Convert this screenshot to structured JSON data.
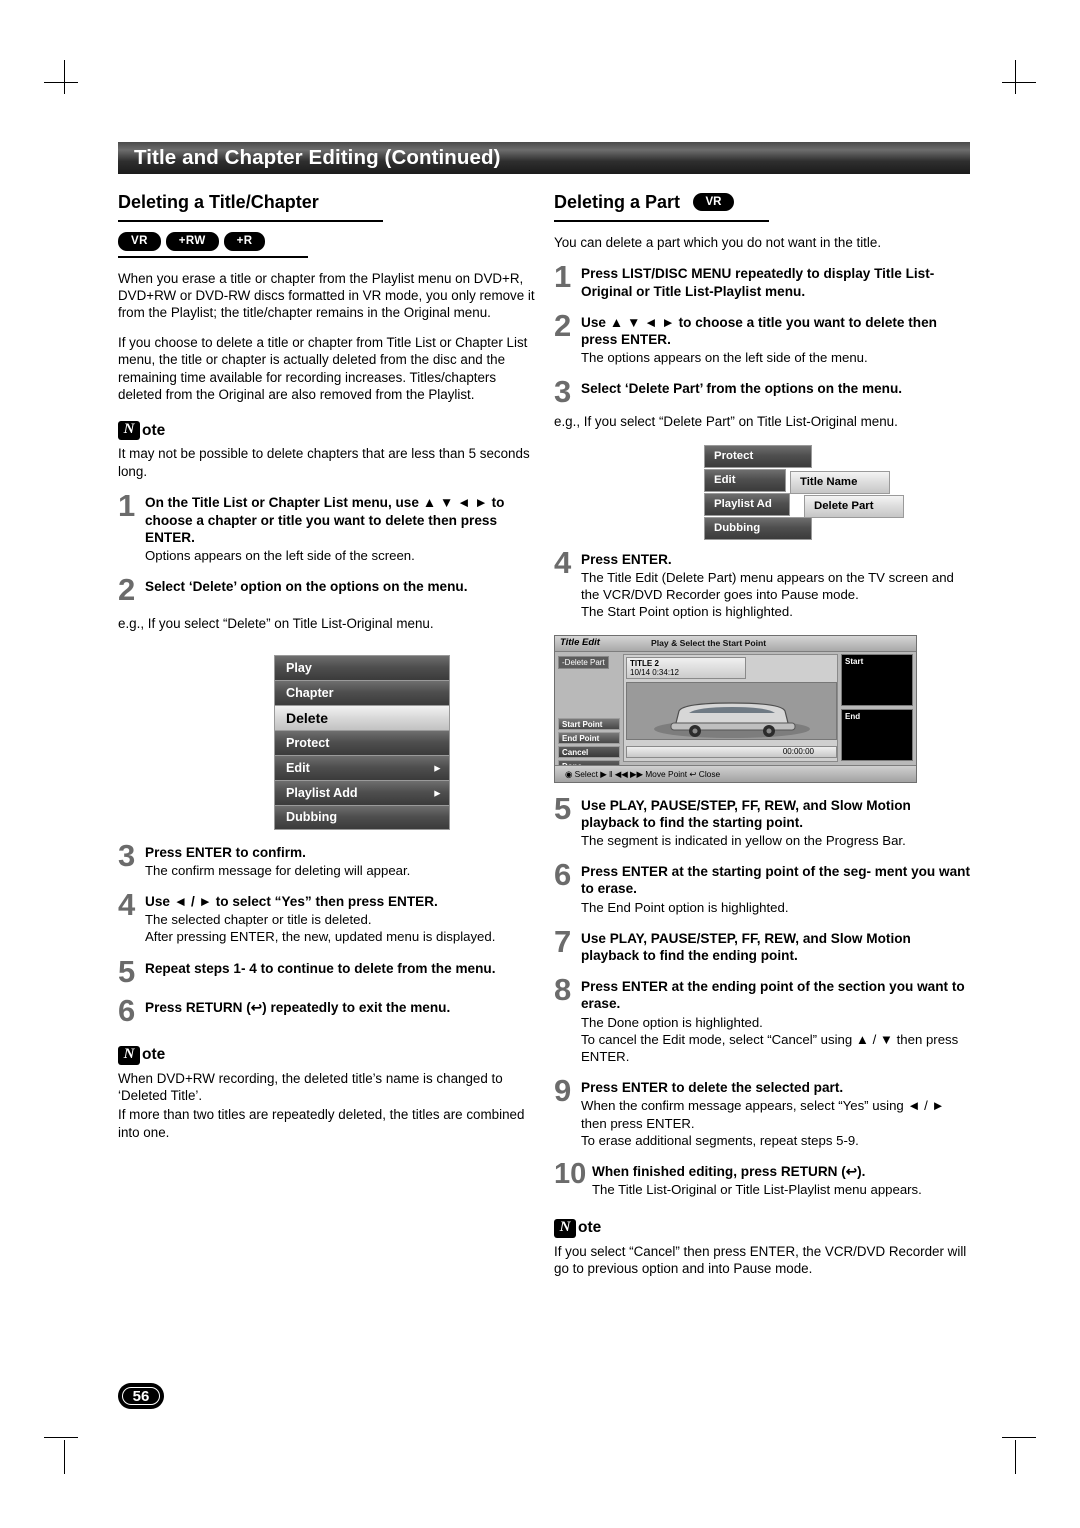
{
  "header": {
    "title": "Title and Chapter Editing (Continued)"
  },
  "page_number": "56",
  "left": {
    "section_title": "Deleting a Title/Chapter",
    "disc_tags": [
      "VR",
      "+RW",
      "+R"
    ],
    "paragraphs": [
      "When you erase a title or chapter from the Playlist menu on DVD+R, DVD+RW or DVD-RW discs formatted in VR mode, you only remove it from the Playlist; the title/chapter remains in the Original menu.",
      "If you choose to delete a title or chapter from Title List or Chapter List menu, the title or chapter is actually deleted from the disc and the remaining time available for recording increases. Titles/chapters deleted from the Original are also removed from the Playlist."
    ],
    "note1": {
      "label": "ote",
      "text": "It may not be possible to delete chapters that are less than 5 seconds long."
    },
    "steps": [
      {
        "num": "1",
        "head": "On the Title List or Chapter List menu, use ▲ ▼ ◄ ► to choose a chapter or title you want to delete then press ENTER.",
        "sub": "Options appears on the left side of the screen."
      },
      {
        "num": "2",
        "head": "Select ‘Delete’ option on the options on the menu.",
        "sub": ""
      }
    ],
    "eg_text": "e.g., If you select “Delete” on Title List-Original menu.",
    "options_menu": [
      {
        "label": "Play",
        "selected": false,
        "arrow": false
      },
      {
        "label": "Chapter",
        "selected": false,
        "arrow": false
      },
      {
        "label": "Delete",
        "selected": true,
        "arrow": false
      },
      {
        "label": "Protect",
        "selected": false,
        "arrow": false
      },
      {
        "label": "Edit",
        "selected": false,
        "arrow": true
      },
      {
        "label": "Playlist Add",
        "selected": false,
        "arrow": true
      },
      {
        "label": "Dubbing",
        "selected": false,
        "arrow": false
      }
    ],
    "steps2": [
      {
        "num": "3",
        "head": "Press ENTER to confirm.",
        "sub": "The confirm message for deleting will appear."
      },
      {
        "num": "4",
        "head": "Use ◄ / ► to select “Yes” then press ENTER.",
        "sub": "The selected chapter or title is deleted.\nAfter pressing ENTER, the new, updated menu is displayed."
      },
      {
        "num": "5",
        "head": "Repeat steps 1- 4 to continue to delete from the menu.",
        "sub": ""
      },
      {
        "num": "6",
        "head": "Press RETURN (↩) repeatedly to exit the menu.",
        "sub": ""
      }
    ],
    "note2": {
      "label": "ote",
      "text1": "When DVD+RW recording, the deleted title’s name is changed to ‘Deleted Title’.",
      "text2": "If more than two titles are repeatedly deleted, the titles are combined into one."
    }
  },
  "right": {
    "section_title": "Deleting a Part",
    "section_tag": "VR",
    "intro": "You can delete a part which you do not want in the title.",
    "steps": [
      {
        "num": "1",
        "head": "Press LIST/DISC MENU repeatedly to display Title List-Original or Title List-Playlist menu.",
        "sub": ""
      },
      {
        "num": "2",
        "head": "Use ▲ ▼ ◄ ► to choose a title you want to delete then press ENTER.",
        "sub": "The options appears on the left side of the menu."
      },
      {
        "num": "3",
        "head": "Select ‘Delete Part’ from the options on the menu.",
        "sub": ""
      }
    ],
    "eg_text": "e.g., If you select “Delete Part” on Title List-Original menu.",
    "delete_part_menu": {
      "items": [
        "Protect",
        "Edit",
        "Playlist Ad",
        "Dubbing"
      ],
      "submenu": [
        "Title Name",
        "Delete Part"
      ]
    },
    "step4": {
      "num": "4",
      "head": "Press ENTER.",
      "sub": "The Title Edit (Delete Part) menu appears on the TV screen and the VCR/DVD Recorder goes into Pause mode.\nThe Start Point option is highlighted."
    },
    "title_edit_screen": {
      "title": "Title Edit",
      "subtitle": "Play & Select the Start Point",
      "mode_chip": "-Delete Part",
      "thumb_label": "TITLE 2",
      "thumb_meta": "10/14        0:34:12",
      "left_buttons": [
        "Start Point",
        "End Point",
        "Cancel",
        "Done"
      ],
      "right_labels": [
        "Start",
        "End"
      ],
      "timecode": "00:00:00",
      "footer": "◉ Select   ▶ ‖ ◀◀ ▶▶     Move Point   ↩ Close"
    },
    "steps5": [
      {
        "num": "5",
        "head": "Use PLAY, PAUSE/STEP, FF, REW, and Slow Motion playback to find the starting point.",
        "sub": "The segment is indicated in yellow on the Progress Bar."
      },
      {
        "num": "6",
        "head": "Press ENTER at the starting point of the seg- ment you want to erase.",
        "sub": "The End Point option is highlighted."
      },
      {
        "num": "7",
        "head": "Use PLAY, PAUSE/STEP, FF, REW, and Slow Motion playback to find the ending point.",
        "sub": ""
      },
      {
        "num": "8",
        "head": "Press ENTER at the ending point of the section you want to erase.",
        "sub": "The Done option is highlighted.\nTo cancel the Edit mode, select “Cancel” using ▲ / ▼ then press ENTER."
      },
      {
        "num": "9",
        "head": "Press ENTER to delete the selected part.",
        "sub": "When the confirm message appears, select “Yes” using ◄ / ► then press ENTER.\nTo erase additional segments, repeat steps 5-9."
      },
      {
        "num": "10",
        "head": "When finished editing, press RETURN (↩).",
        "sub": "The Title List-Original or Title List-Playlist menu appears."
      }
    ],
    "note": {
      "label": "ote",
      "text": "If you select “Cancel” then press ENTER, the VCR/DVD Recorder will go to previous option and into Pause mode."
    }
  }
}
